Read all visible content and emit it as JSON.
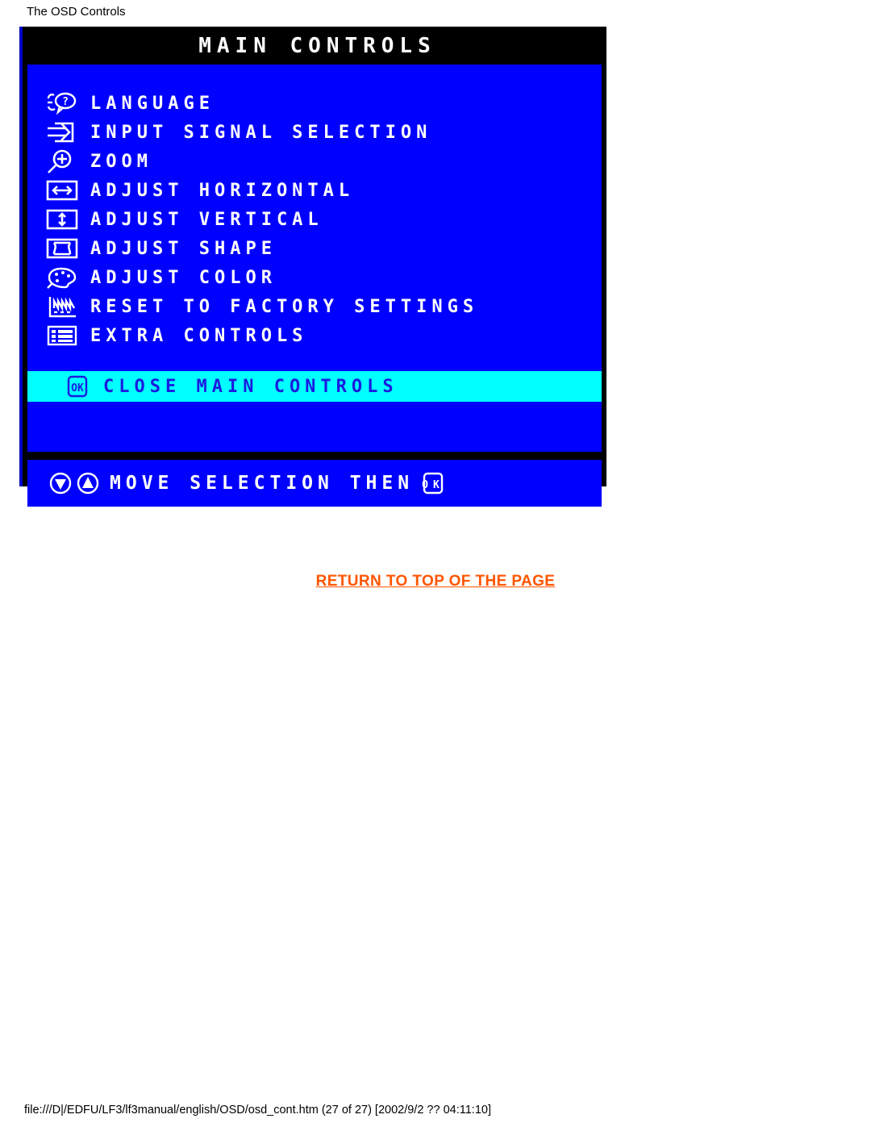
{
  "page": {
    "heading": "The OSD Controls",
    "return_link": "RETURN TO TOP OF THE PAGE",
    "footer": "file:///D|/EDFU/LF3/lf3manual/english/OSD/osd_cont.htm (27 of 27) [2002/9/2 ?? 04:11:10]"
  },
  "colors": {
    "osd_background": "#0000FF",
    "osd_title_bar": "#000000",
    "osd_title_text": "#FFFFFF",
    "menu_text": "#FFFFFF",
    "highlight_background": "#00FFFF",
    "highlight_text": "#1B1BE0",
    "link": "#FF5500",
    "page_background": "#FFFFFF"
  },
  "osd": {
    "title": "MAIN CONTROLS",
    "items": [
      {
        "label": "LANGUAGE",
        "icon": "head-question-icon"
      },
      {
        "label": "INPUT SIGNAL SELECTION",
        "icon": "input-arrow-icon"
      },
      {
        "label": "ZOOM",
        "icon": "magnifier-plus-icon"
      },
      {
        "label": "ADJUST HORIZONTAL",
        "icon": "horizontal-arrows-icon"
      },
      {
        "label": "ADJUST VERTICAL",
        "icon": "vertical-arrows-icon"
      },
      {
        "label": "ADJUST SHAPE",
        "icon": "shape-pincushion-icon"
      },
      {
        "label": "ADJUST COLOR",
        "icon": "palette-icon"
      },
      {
        "label": "RESET TO FACTORY SETTINGS",
        "icon": "waveform-reset-icon"
      },
      {
        "label": "EXTRA CONTROLS",
        "icon": "list-lines-icon"
      }
    ],
    "selected": {
      "label": "CLOSE MAIN CONTROLS",
      "icon": "ok-badge-icon"
    },
    "hint": {
      "label": "MOVE SELECTION THEN",
      "icons": [
        "down-arrow-circle-icon",
        "up-arrow-circle-icon",
        "ok-badge-icon"
      ]
    }
  }
}
